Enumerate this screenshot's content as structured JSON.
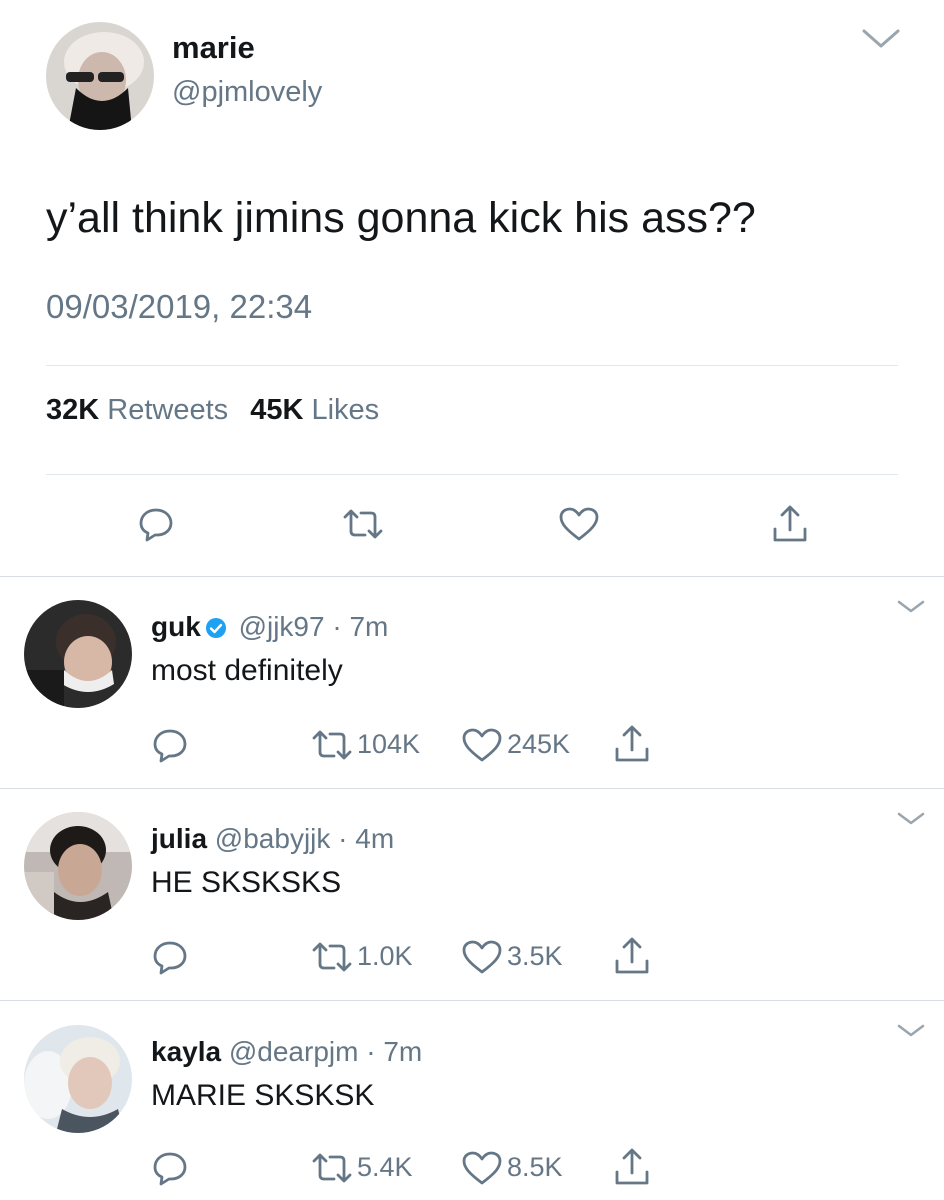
{
  "main_tweet": {
    "name": "marie",
    "handle": "@pjmlovely",
    "text": "y’all think jimins gonna kick his ass??",
    "timestamp": "09/03/2019, 22:34",
    "retweets_count": "32K",
    "retweets_label": "Retweets",
    "likes_count": "45K",
    "likes_label": "Likes",
    "actions": [
      "reply-icon",
      "retweet-icon",
      "like-icon",
      "share-icon"
    ]
  },
  "replies": [
    {
      "name": "guk",
      "verified": true,
      "handle": "@jjk97",
      "time": "7m",
      "text": "most definitely",
      "retweets": "104K",
      "likes": "245K"
    },
    {
      "name": "julia",
      "verified": false,
      "handle": "@babyjjk",
      "time": "4m",
      "text": "HE SKSKSKS",
      "retweets": "1.0K",
      "likes": "3.5K"
    },
    {
      "name": "kayla",
      "verified": false,
      "handle": "@dearpjm",
      "time": "7m",
      "text": "MARIE SKSKSK",
      "retweets": "5.4K",
      "likes": "8.5K"
    }
  ],
  "separator": "·",
  "colors": {
    "text": "#14171a",
    "muted": "#657786",
    "divider": "#e1e8ed",
    "verified": "#1da1f2"
  }
}
